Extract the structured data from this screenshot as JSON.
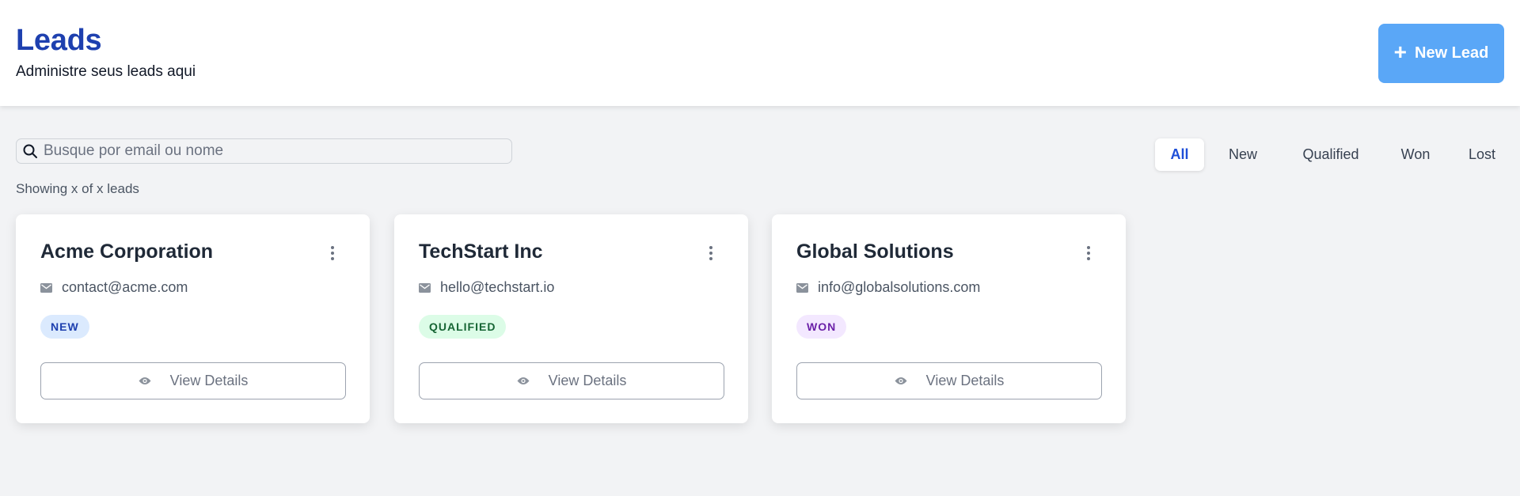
{
  "header": {
    "title": "Leads",
    "subtitle": "Administre seus leads aqui",
    "new_lead_label": "New Lead",
    "accent": "#1e40af",
    "button_color": "#5aa7f7"
  },
  "search": {
    "placeholder": "Busque por email ou nome",
    "value": ""
  },
  "count_text": "Showing x of x leads",
  "filters": [
    {
      "label": "All",
      "active": true
    },
    {
      "label": "New",
      "active": false
    },
    {
      "label": "Qualified",
      "active": false
    },
    {
      "label": "Won",
      "active": false
    },
    {
      "label": "Lost",
      "active": false
    }
  ],
  "leads": [
    {
      "name": "Acme Corporation",
      "email": "contact@acme.com",
      "status": "NEW",
      "badge_bg": "#dbeafe",
      "badge_fg": "#1e40af",
      "action": "View Details"
    },
    {
      "name": "TechStart Inc",
      "email": "hello@techstart.io",
      "status": "QUALIFIED",
      "badge_bg": "#dcfce7",
      "badge_fg": "#166534",
      "action": "View Details"
    },
    {
      "name": "Global Solutions",
      "email": "info@globalsolutions.com",
      "status": "WON",
      "badge_bg": "#f3e8ff",
      "badge_fg": "#6b21a8",
      "action": "View Details"
    }
  ]
}
